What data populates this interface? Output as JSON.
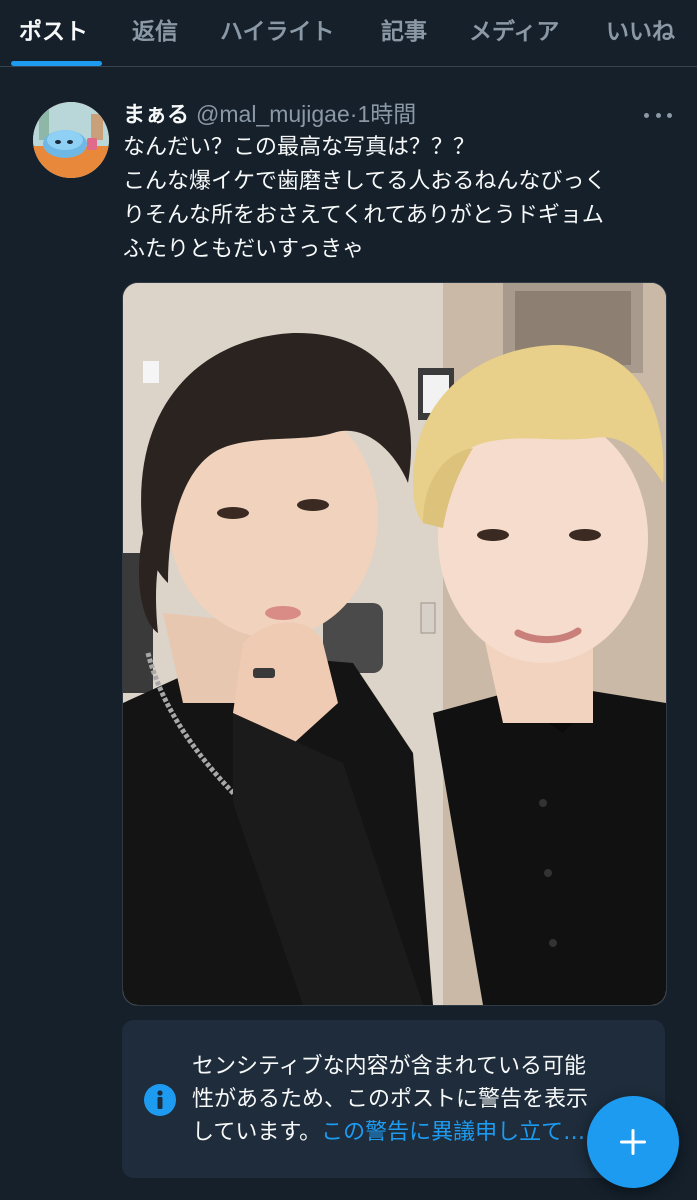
{
  "tabs": [
    {
      "label": "ポスト",
      "active": true
    },
    {
      "label": "返信"
    },
    {
      "label": "ハイライト"
    },
    {
      "label": "記事"
    },
    {
      "label": "メディア"
    },
    {
      "label": "いいね"
    }
  ],
  "post": {
    "display_name": "まぁる",
    "handle": "@mal_mujigae",
    "separator": "·",
    "time": "1時間",
    "text_lines": [
      "なんだい？この最高な写真は？？？",
      "こんな爆イケで歯磨きしてる人おるねんなびっく",
      "りそんな所をおさえてくれてありがとうドギョム",
      "ふたりともだいすっきゃ"
    ],
    "avatar_icon": "avatar-illustration",
    "more_icon": "more-dots-icon",
    "media_icon": "selfie-photo"
  },
  "warning": {
    "icon": "info-icon",
    "lines": [
      "センシティブな内容が含まれている可能",
      "性があるため、このポストに警告を表示",
      "しています。"
    ],
    "link": "この警告に異議申し立て…"
  },
  "fab": {
    "icon": "plus-icon"
  },
  "colors": {
    "background": "#15202b",
    "accent": "#1d9bf0",
    "secondary_text": "#8b98a5",
    "warning_bg": "#1e2c3b"
  }
}
